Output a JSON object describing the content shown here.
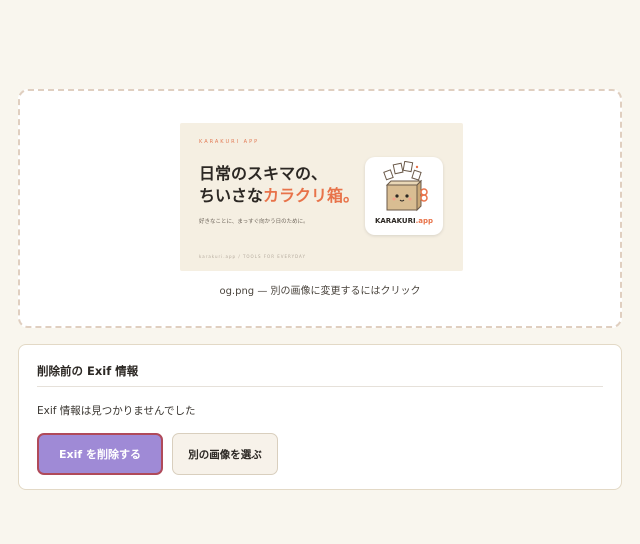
{
  "colors": {
    "background": "#f9f6ee",
    "primary_button": "#9f8ad6",
    "primary_button_border": "#b04a5a",
    "accent": "#e8734a"
  },
  "preview": {
    "image": {
      "brand": "KARAKURI APP",
      "headline_line1": "日常のスキマの、",
      "headline_line2_prefix": "ちいさな",
      "headline_line2_accent": "カラクリ箱。",
      "subtitle": "好きなことに、まっすぐ向かう日のために。",
      "footer": "karakuri.app / TOOLS FOR EVERYDAY",
      "icon_label_main": "KARAKURI",
      "icon_label_suffix": ".app",
      "mascot_icon": "box-mascot-icon"
    },
    "caption": "og.png — 別の画像に変更するにはクリック"
  },
  "exif_panel": {
    "title": "削除前の Exif 情報",
    "message": "Exif 情報は見つかりませんでした",
    "remove_button": "Exif を削除する",
    "choose_button": "別の画像を選ぶ"
  }
}
